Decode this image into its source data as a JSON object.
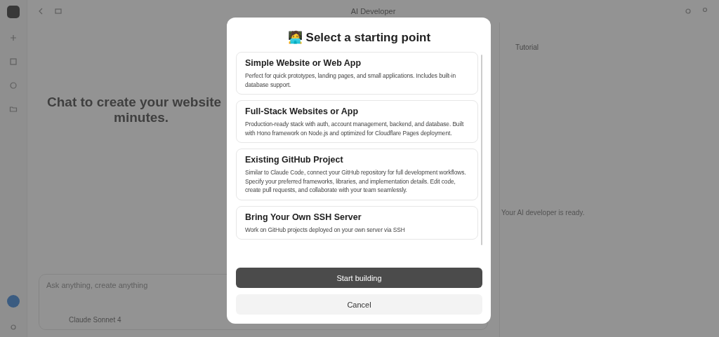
{
  "app": {
    "title": "AI Developer",
    "heading_lines": [
      "Chat to create your website",
      "minutes."
    ],
    "input": {
      "placeholder": "Ask anything, create anything"
    },
    "model": "Claude Sonnet 4",
    "tab": "Tutorial",
    "status": "Your AI developer is ready."
  },
  "dialog": {
    "icon": "🧑‍💻",
    "title": "Select a starting point",
    "options": [
      {
        "title": "Simple Website or Web App",
        "description": "Perfect for quick prototypes, landing pages, and small applications. Includes built-in database support.",
        "selected": false
      },
      {
        "title": "Full-Stack Websites or App",
        "description": "Production-ready stack with auth, account management, backend, and database. Built with Hono framework on Node.js and optimized for Cloudflare Pages deployment.",
        "selected": false
      },
      {
        "title": "Existing GitHub Project",
        "description": "Similar to Claude Code, connect your GitHub repository for full development workflows. Specify your preferred frameworks, libraries, and implementation details. Edit code, create pull requests, and collaborate with your team seamlessly.",
        "selected": false
      },
      {
        "title": "Bring Your Own SSH Server",
        "description": "Work on GitHub projects deployed on your own server via SSH",
        "selected": false
      }
    ],
    "buttons": [
      {
        "label": "Start building",
        "kind": "primary"
      },
      {
        "label": "Cancel",
        "kind": "secondary"
      }
    ]
  }
}
